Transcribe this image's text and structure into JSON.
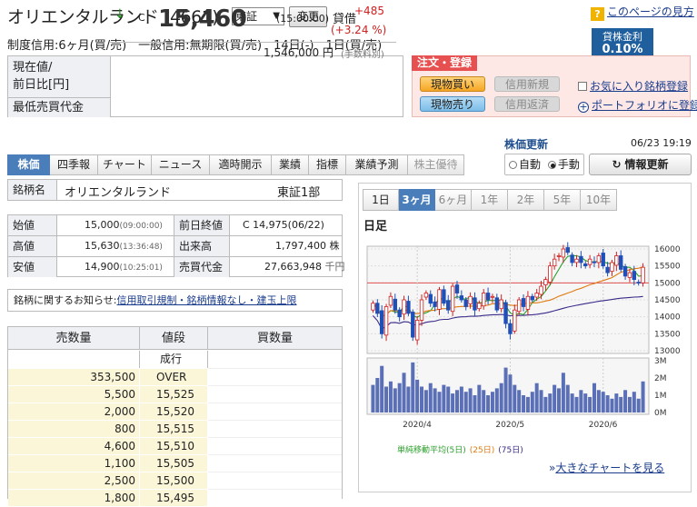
{
  "header": {
    "title": "オリエンタルランド (4661)",
    "market": "東証",
    "change_button": "変更",
    "taishaku": "貸借",
    "help_link": "このページの見方",
    "lending_label": "貸株金利",
    "lending_rate": "0.10%",
    "credit_line": "制度信用:6ヶ月(買/売)　一般信用:無期限(買/売)　14日(-)　1日(買/売)"
  },
  "price": {
    "label": "現在値/\n前日比[円]",
    "label1": "現在値/",
    "label2": "前日比[円]",
    "arrow": "↓",
    "c_mark": "C",
    "value": "15,460",
    "time": "(15:00:00)",
    "change_abs": "+485",
    "change_pct": "(+3.24 %)",
    "min_label": "最低売買代金",
    "min_value": "1,546,000",
    "min_unit_yen": "円",
    "min_fee": "(手数料別)"
  },
  "order": {
    "tab": "注文・登録",
    "genbutsu_buy": "現物買い",
    "genbutsu_sell": "現物売り",
    "credit_new": "信用新規",
    "credit_return": "信用返済",
    "favorite": "お気に入り銘柄登録",
    "portfolio": "ポートフォリオに登録"
  },
  "tabs": [
    "株価",
    "四季報",
    "チャート",
    "ニュース",
    "適時開示",
    "業績",
    "指標",
    "業績予測",
    "株主優待"
  ],
  "name_row": {
    "label": "銘柄名",
    "name": "オリエンタルランド",
    "market": "東証1部"
  },
  "ohlc": [
    {
      "l1": "始値",
      "v1": "15,000",
      "t1": "(09:00:00)",
      "l2": "前日終値",
      "v2": "C 14,975(06/22)"
    },
    {
      "l1": "高値",
      "v1": "15,630",
      "t1": "(13:36:48)",
      "l2": "出来高",
      "v2": "1,797,400",
      "u2": "株"
    },
    {
      "l1": "安値",
      "v1": "14,900",
      "t1": "(10:25:01)",
      "l2": "売買代金",
      "v2": "27,663,948",
      "u2": "千円"
    }
  ],
  "notice": {
    "prefix": "銘柄に関するお知らせ:",
    "link": "信用取引規制・銘柄情報なし・建玉上限"
  },
  "board": {
    "headers": [
      "売数量",
      "値段",
      "買数量"
    ],
    "market_order": "成行",
    "rows": [
      {
        "sell": "353,500",
        "price": "OVER"
      },
      {
        "sell": "5,500",
        "price": "15,525"
      },
      {
        "sell": "2,000",
        "price": "15,520"
      },
      {
        "sell": "800",
        "price": "15,515"
      },
      {
        "sell": "4,600",
        "price": "15,510"
      },
      {
        "sell": "1,100",
        "price": "15,505"
      },
      {
        "sell": "2,500",
        "price": "15,500"
      },
      {
        "sell": "1,800",
        "price": "15,495"
      }
    ]
  },
  "right": {
    "update_label": "株価更新",
    "update_time": "06/23 19:19",
    "auto": "自動",
    "manual": "手動",
    "info_update": "情報更新"
  },
  "chart_tabs": [
    "1日",
    "3ヶ月",
    "6ヶ月",
    "1年",
    "2年",
    "5年",
    "10年"
  ],
  "chart_title": "日足",
  "legend": {
    "prefix": "単純移動平均",
    "ma5": "(5日)",
    "ma25": "(25日)",
    "ma75": "(75日)"
  },
  "big_chart_link": "大きなチャートを見る",
  "colors": {
    "up": "#d02020",
    "candle": "#1f4fb8",
    "ma5": "#2ca02c",
    "ma25": "#e07b10",
    "ma75": "#3b2a8a",
    "tab_active": "#4a7ebb"
  },
  "chart_data": {
    "type": "candlestick",
    "y_ticks": [
      "16000",
      "15500",
      "15000",
      "14500",
      "14000",
      "13500",
      "13000"
    ],
    "ylim": [
      13000,
      16000
    ],
    "reference_line": 15000,
    "x_ticks": [
      "2020/4",
      "2020/5",
      "2020/6"
    ],
    "volume_ticks": [
      "3M",
      "2M",
      "1M",
      "0M"
    ],
    "close": [
      14400,
      14100,
      13500,
      14300,
      14600,
      14200,
      14000,
      14500,
      14100,
      13400,
      13900,
      14500,
      14700,
      14400,
      14300,
      14800,
      14400,
      14200,
      14900,
      14700,
      14500,
      14300,
      14600,
      14200,
      14400,
      14700,
      14500,
      14600,
      14200,
      14500,
      13800,
      13500,
      14200,
      14500,
      14300,
      14600,
      14500,
      14700,
      14900,
      15100,
      15500,
      15700,
      15800,
      16000,
      15900,
      15600,
      15700,
      15600,
      15500,
      15700,
      15600,
      15800,
      15500,
      15300,
      15600,
      15800,
      15400,
      15200,
      15300,
      15100,
      15000,
      15460
    ],
    "volume": [
      1.6,
      2.0,
      2.7,
      1.5,
      1.8,
      1.4,
      1.7,
      2.3,
      1.5,
      2.9,
      1.9,
      1.5,
      1.3,
      1.7,
      1.4,
      1.2,
      1.6,
      1.5,
      1.1,
      1.3,
      1.5,
      1.2,
      1.4,
      1.0,
      1.6,
      1.3,
      1.0,
      1.2,
      1.4,
      1.7,
      2.6,
      2.2,
      1.6,
      1.3,
      1.0,
      0.9,
      1.2,
      1.7,
      1.3,
      0.9,
      1.1,
      1.6,
      1.4,
      2.3,
      1.6,
      1.1,
      0.9,
      1.3,
      1.1,
      0.9,
      1.7,
      1.3,
      1.2,
      1.0,
      0.8,
      1.1,
      0.9,
      1.3,
      0.9,
      1.2,
      0.8,
      1.8
    ]
  }
}
